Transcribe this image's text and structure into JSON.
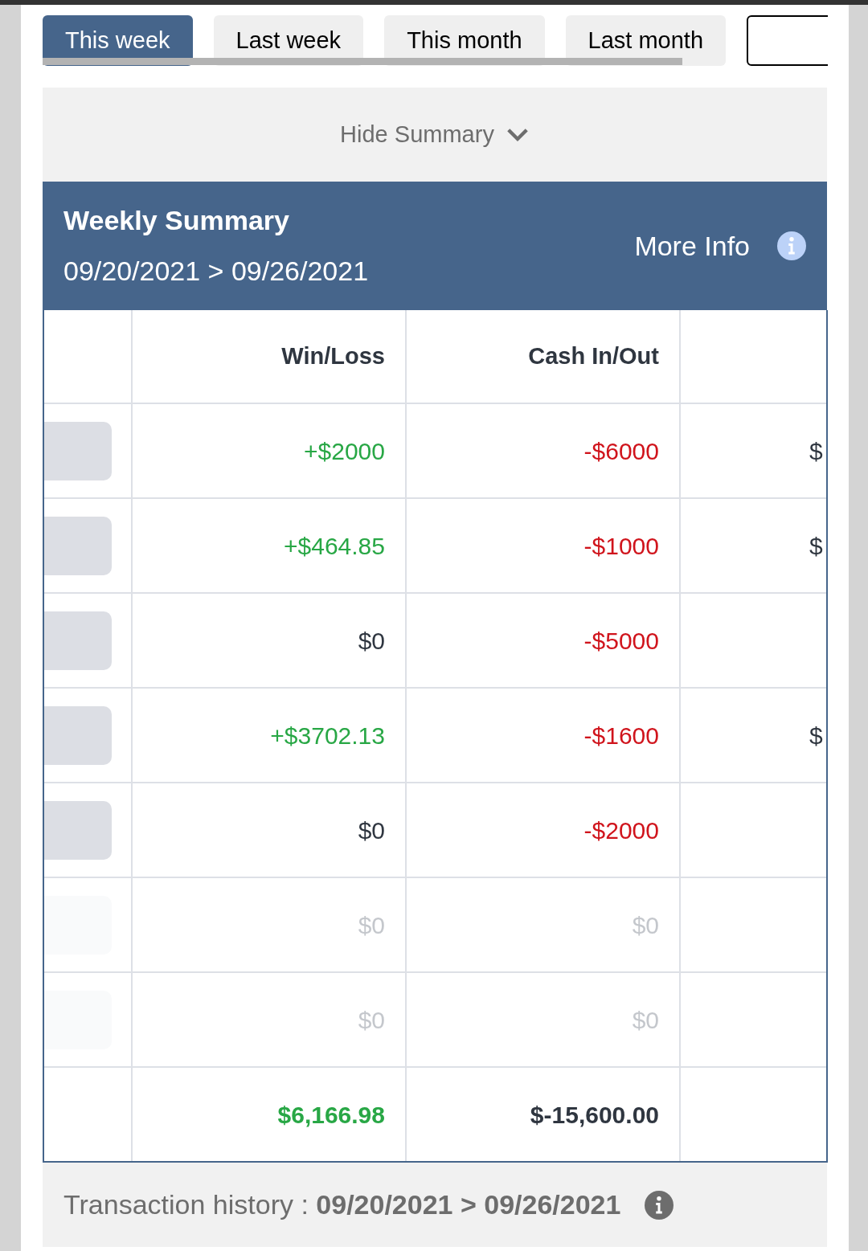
{
  "tabs": [
    {
      "label": "This week",
      "selected": true
    },
    {
      "label": "Last week",
      "selected": false
    },
    {
      "label": "This month",
      "selected": false
    },
    {
      "label": "Last month",
      "selected": false
    }
  ],
  "summary_toggle": {
    "label": "Hide Summary",
    "expanded": true
  },
  "summary": {
    "title": "Weekly Summary",
    "date_range": "09/20/2021 > 09/26/2021",
    "more_info": "More Info"
  },
  "table": {
    "columns": [
      "",
      "Win/Loss",
      "Cash In/Out",
      ""
    ],
    "rows": [
      {
        "disabled": false,
        "win_loss": {
          "text": "+$2000",
          "color": "#28a745"
        },
        "cash": {
          "text": "-$6000",
          "color": "#d0141c"
        },
        "column_4": "$"
      },
      {
        "disabled": false,
        "win_loss": {
          "text": "+$464.85",
          "color": "#28a745"
        },
        "cash": {
          "text": "-$1000",
          "color": "#d0141c"
        },
        "column_4": "$"
      },
      {
        "disabled": false,
        "win_loss": {
          "text": "$0",
          "color": "#2f3640"
        },
        "cash": {
          "text": "-$5000",
          "color": "#d0141c"
        }
      },
      {
        "disabled": false,
        "win_loss": {
          "text": "+$3702.13",
          "color": "#28a745"
        },
        "cash": {
          "text": "-$1600",
          "color": "#d0141c"
        },
        "column_4": "$"
      },
      {
        "disabled": false,
        "win_loss": {
          "text": "$0",
          "color": "#2f3640"
        },
        "cash": {
          "text": "-$2000",
          "color": "#d0141c"
        }
      },
      {
        "disabled": true,
        "win_loss": {
          "text": "$0",
          "color": "#c4c7cc"
        },
        "cash": {
          "text": "$0",
          "color": "#c4c7cc"
        }
      },
      {
        "disabled": true,
        "win_loss": {
          "text": "$0",
          "color": "#c4c7cc"
        },
        "cash": {
          "text": "$0",
          "color": "#c4c7cc"
        }
      }
    ],
    "total": {
      "win_loss": {
        "text": "$6,166.98",
        "color": "#28a745"
      },
      "cash": {
        "text": "$-15,600.00",
        "color": "#2f3640"
      }
    }
  },
  "footer": {
    "label": "Transaction history : ",
    "date_range": "09/20/2021 > 09/26/2021"
  }
}
